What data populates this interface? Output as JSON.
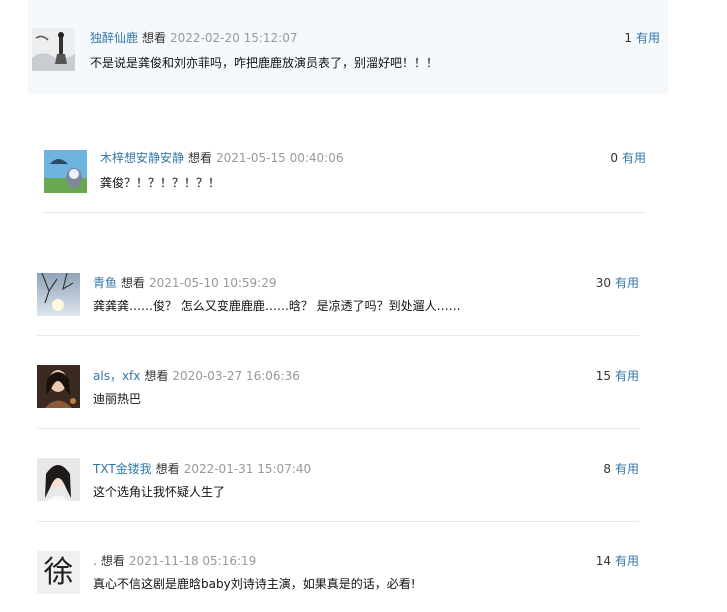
{
  "comments": [
    {
      "user": "独醉仙鹿",
      "rating": "想看",
      "time": "2022-02-20 15:12:07",
      "votes": "1",
      "useful": "有用",
      "content": "不是说是龚俊和刘亦菲吗，咋把鹿鹿放演员表了，别溜好吧！！！"
    },
    {
      "user": "木梓想安静安静",
      "rating": "想看",
      "time": "2021-05-15 00:40:06",
      "votes": "0",
      "useful": "有用",
      "content": "龚俊？！？！？！？！"
    },
    {
      "user": "青鱼",
      "rating": "想看",
      "time": "2021-05-10 10:59:29",
      "votes": "30",
      "useful": "有用",
      "content": "龚龚龚……俊？ 怎么又变鹿鹿鹿……晗？ 是凉透了吗？到处遛人……"
    },
    {
      "user": "als，xfx",
      "rating": "想看",
      "time": "2020-03-27 16:06:36",
      "votes": "15",
      "useful": "有用",
      "content": "迪丽热巴"
    },
    {
      "user": "TXT金镂我",
      "rating": "想看",
      "time": "2022-01-31 15:07:40",
      "votes": "8",
      "useful": "有用",
      "content": "这个选角让我怀疑人生了"
    },
    {
      "user": ".",
      "rating": "想看",
      "time": "2021-11-18 05:16:19",
      "votes": "14",
      "useful": "有用",
      "content": "真心不信这剧是鹿晗baby刘诗诗主演，如果真是的话，必看!",
      "avatar_text": "徐"
    }
  ]
}
